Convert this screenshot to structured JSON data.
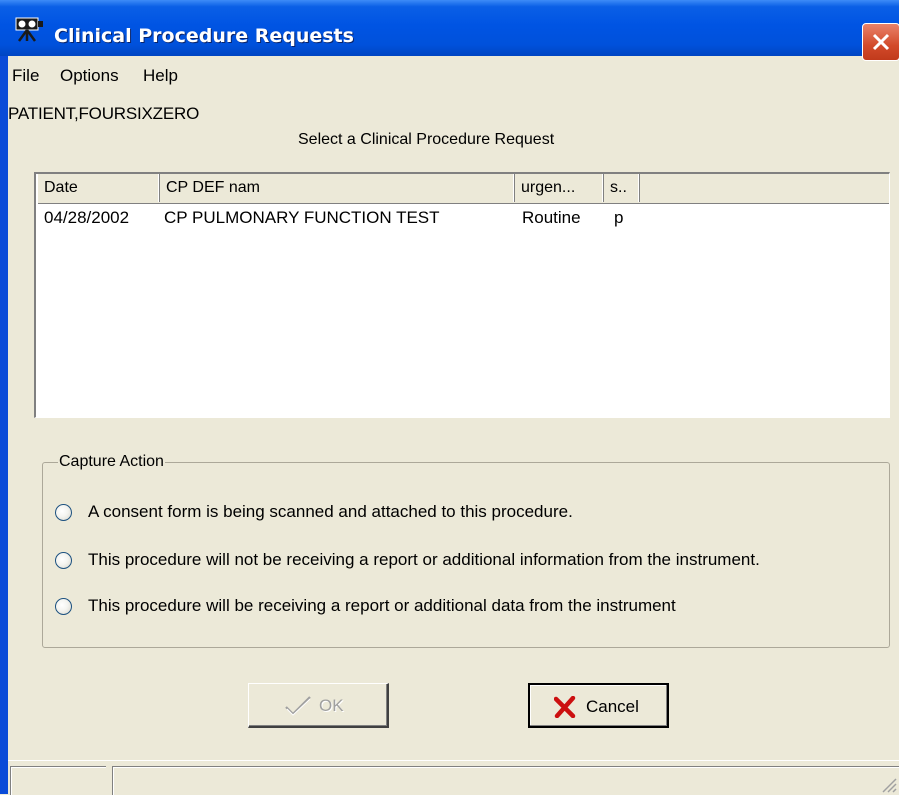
{
  "window": {
    "title": "Clinical Procedure Requests",
    "icon": "camera-tripod-icon",
    "colors": {
      "titlebar": "#0054e3",
      "close_button": "#d24a2a",
      "face": "#ece9d8",
      "list_background": "#ffffff"
    }
  },
  "menu": {
    "items": [
      "File",
      "Options",
      "Help"
    ]
  },
  "patient": {
    "name": "PATIENT,FOURSIXZERO"
  },
  "list": {
    "caption": "Select a Clinical Procedure Request",
    "columns": [
      "Date",
      "CP DEF nam",
      "urgen...",
      "s.."
    ],
    "rows": [
      {
        "date": "04/28/2002",
        "cp_def_name": "CP PULMONARY FUNCTION TEST",
        "urgency": "Routine",
        "status": "p"
      }
    ]
  },
  "capture_action": {
    "legend": "Capture Action",
    "options": [
      {
        "label": "A consent form is being scanned and attached to this procedure.",
        "selected": false
      },
      {
        "label": "This procedure will not be receiving a report or additional information from the instrument.",
        "selected": false
      },
      {
        "label": "This procedure will be receiving a report or additional data from the instrument",
        "selected": false
      }
    ]
  },
  "buttons": {
    "ok": {
      "label": "OK",
      "enabled": false,
      "icon": "checkmark-icon"
    },
    "cancel": {
      "label": "Cancel",
      "enabled": true,
      "icon": "red-x-icon"
    }
  }
}
